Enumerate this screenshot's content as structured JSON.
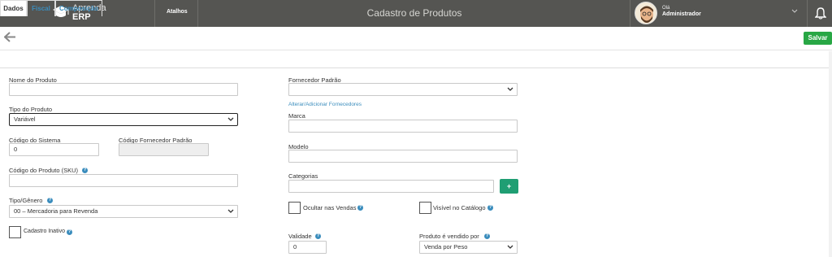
{
  "header": {
    "logo_line1": "Aprenda",
    "logo_line2": "ERP",
    "shortcuts_label": "Atalhos",
    "title": "Cadastro de Produtos",
    "greeting": "Olá",
    "user_name": "Administrador",
    "icons": [
      "graduation-cap-icon",
      "chevron-down-icon",
      "bell-icon"
    ]
  },
  "toolbar": {
    "back_icon": "arrow-left-icon",
    "save_label": "Salvar",
    "save_color": "#28a745"
  },
  "tabs": [
    {
      "label": "Dados",
      "active": true
    },
    {
      "label": "Fiscal",
      "active": false
    },
    {
      "label": "Composição",
      "active": false
    }
  ],
  "form": {
    "product_name": {
      "label": "Nome do Produto",
      "value": ""
    },
    "product_type": {
      "label": "Tipo do Produto",
      "value": "Variável"
    },
    "system_code": {
      "label": "Código do Sistema",
      "value": "0"
    },
    "supplier_code": {
      "label": "Código Fornecedor Padrão",
      "value": ""
    },
    "sku": {
      "label": "Código do Produto (SKU)",
      "value": ""
    },
    "genre": {
      "label": "Tipo/Gênero",
      "value": "00 – Mercadoria para Revenda"
    },
    "inactive": {
      "label": "Cadastro Inativo",
      "checked": false
    },
    "default_supplier": {
      "label": "Fornecedor Padrão",
      "value": ""
    },
    "supplier_link": "Alterar/Adicionar Fornecedores",
    "brand": {
      "label": "Marca",
      "value": ""
    },
    "model": {
      "label": "Modelo",
      "value": ""
    },
    "categories": {
      "label": "Categorias",
      "value": "",
      "add_label": "+"
    },
    "hide_sales": {
      "label": "Ocultar nas Vendas",
      "checked": false
    },
    "visible_catalog": {
      "label": "Visível no Catálogo",
      "checked": false
    },
    "validity": {
      "label": "Validade",
      "value": "0"
    },
    "sold_by": {
      "label": "Produto é vendido por",
      "value": "Venda por Peso"
    }
  },
  "colors": {
    "topbar": "#555552",
    "accent": "#3b8dbd",
    "green": "#28a745"
  }
}
